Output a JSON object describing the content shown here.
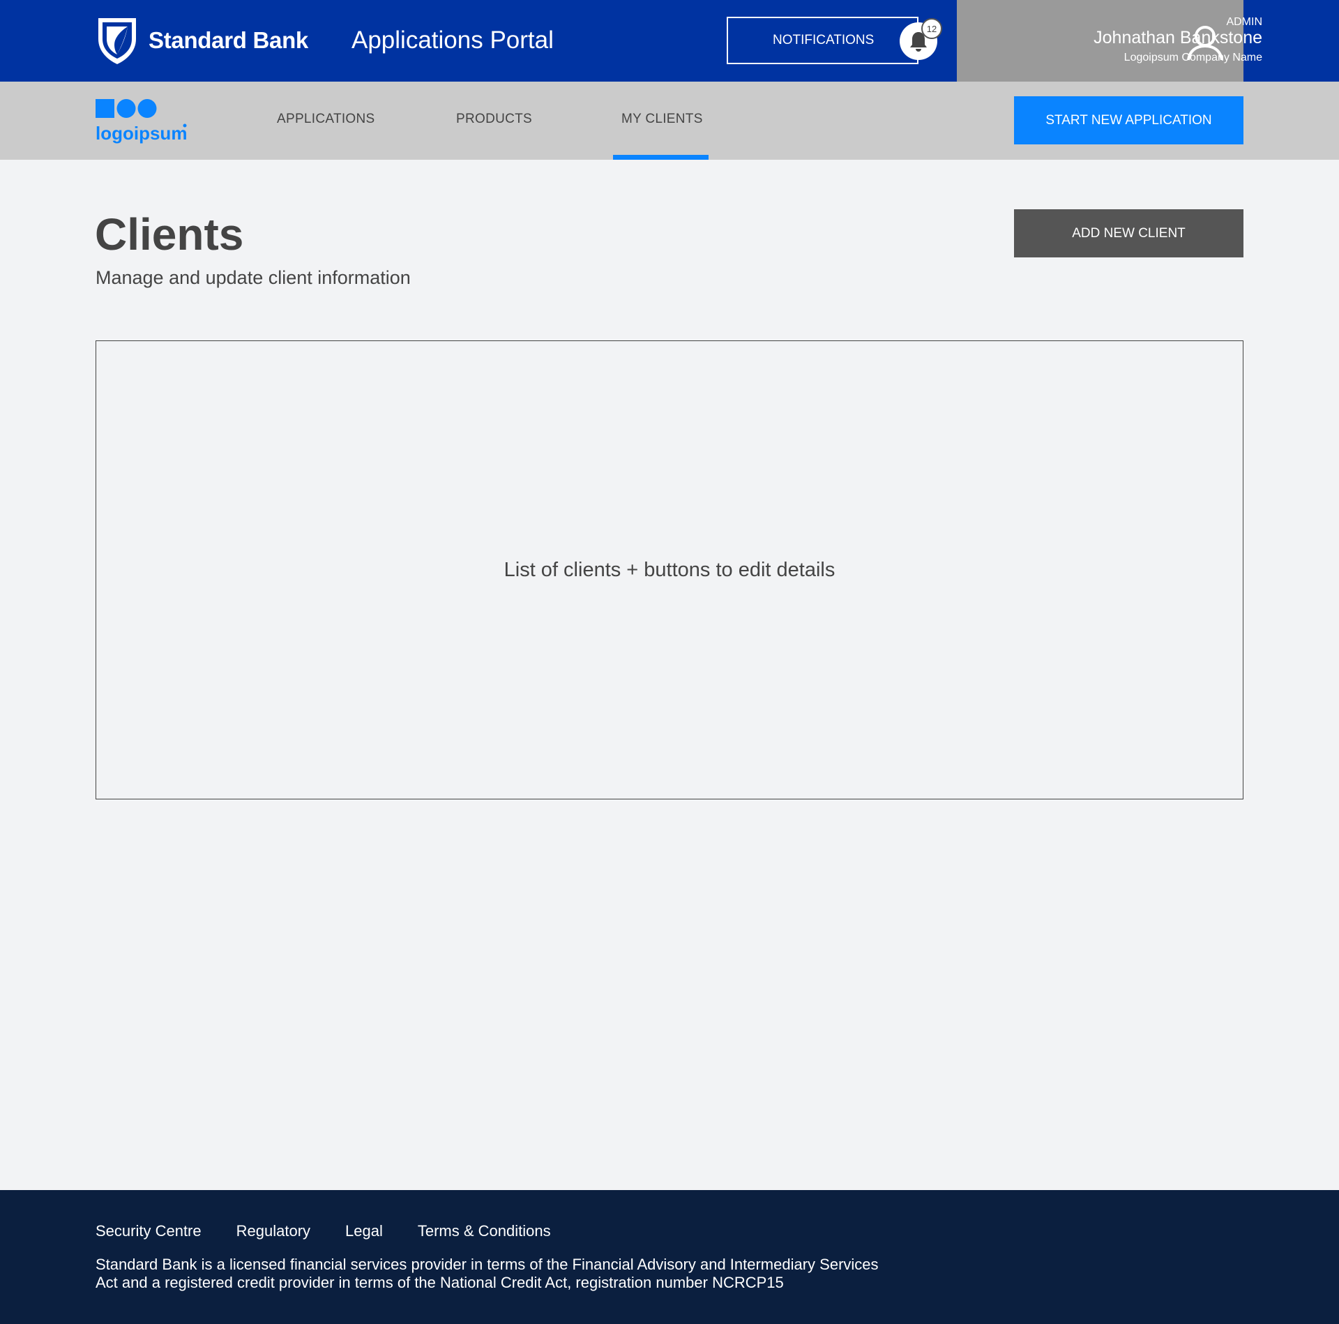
{
  "header": {
    "brand_name": "Standard Bank",
    "portal_title": "Applications Portal",
    "notifications_label": "NOTIFICATIONS",
    "notification_count": "12",
    "user": {
      "role": "ADMIN",
      "name": "Johnathan Bankstone",
      "company": "Logoipsum Company Name"
    }
  },
  "nav": {
    "logo_text": "logoipsum",
    "items": [
      {
        "label": "APPLICATIONS",
        "active": false
      },
      {
        "label": "PRODUCTS",
        "active": false
      },
      {
        "label": "MY CLIENTS",
        "active": true
      }
    ],
    "start_button_label": "START NEW APPLICATION"
  },
  "page": {
    "title": "Clients",
    "subtitle": "Manage and update client information",
    "add_button_label": "ADD NEW  CLIENT",
    "placeholder_text": "List of clients + buttons to edit details"
  },
  "footer": {
    "links": [
      "Security Centre",
      "Regulatory",
      "Legal",
      "Terms & Conditions"
    ],
    "legal_line_1": "Standard Bank is a licensed financial services provider in terms of the Financial Advisory and Intermediary Services",
    "legal_line_2": "Act and a registered credit provider in terms of the National Credit Act, registration number NCRCP15"
  },
  "colors": {
    "header_blue": "#0033a1",
    "accent_blue": "#0a84ff",
    "user_panel_gray": "#9a9a9a",
    "nav_gray": "#cbcbcb",
    "footer_navy": "#0b1f3f",
    "add_button_gray": "#555555"
  },
  "icons": {
    "brand": "standard-bank-shield-icon",
    "notifications": "bell-icon",
    "user": "user-icon",
    "logo": "logoipsum-logo-icon"
  }
}
